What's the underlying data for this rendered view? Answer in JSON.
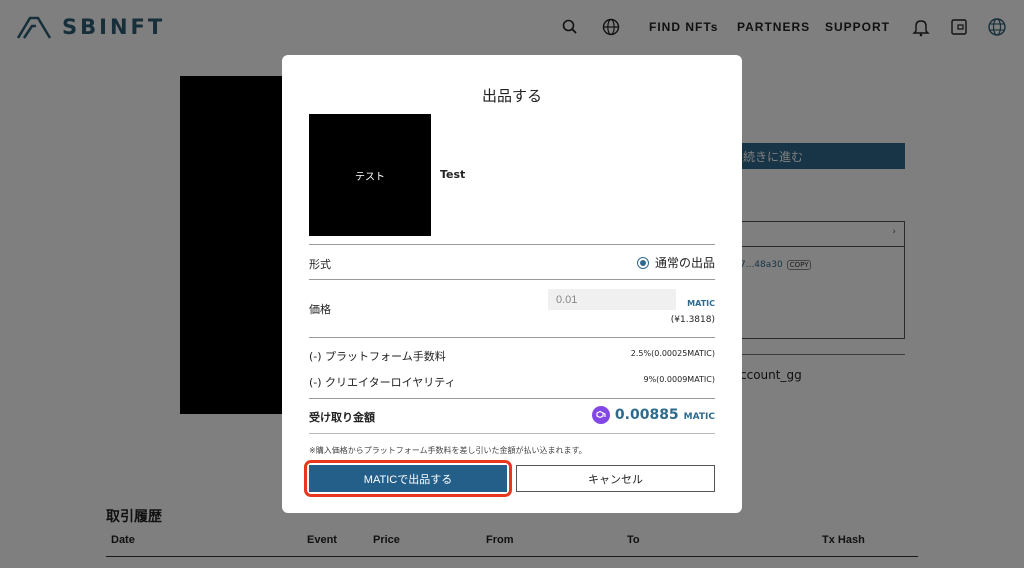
{
  "header": {
    "logo_text": "SBINFT",
    "nav": [
      "FIND NFTs",
      "PARTNERS",
      "SUPPORT"
    ],
    "icons": [
      "search-icon",
      "globe-icon",
      "bell-icon",
      "wallet-icon",
      "network-icon"
    ]
  },
  "background": {
    "proceed_button": "続きに進む",
    "address_text": "7...48a30",
    "copy_label": "COPY",
    "account_text": "ccount_gg",
    "history": {
      "title": "取引履歴",
      "columns": [
        "Date",
        "Event",
        "Price",
        "From",
        "To",
        "Tx Hash"
      ]
    }
  },
  "modal": {
    "title": "出品する",
    "thumbnail_text": "テスト",
    "item_name": "Test",
    "format_label": "形式",
    "format_option": "通常の出品",
    "price_label": "価格",
    "price_value": "0.01",
    "price_unit": "MATIC",
    "price_jpy": "(¥1.3818)",
    "fees": [
      {
        "label": "(-) プラットフォーム手数料",
        "value": "2.5%(0.00025MATIC)"
      },
      {
        "label": "(-) クリエイターロイヤリティ",
        "value": "9%(0.0009MATIC)"
      }
    ],
    "receive_label": "受け取り金額",
    "receive_amount": "0.00885",
    "receive_unit": "MATIC",
    "note": "※購入価格からプラットフォーム手数料を差し引いた金額が払い込まれます。",
    "submit_button": "MATICで出品する",
    "cancel_button": "キャンセル"
  },
  "colors": {
    "accent": "#2f6a8e",
    "primary_button": "#245f8a",
    "highlight": "#e8361f",
    "polygon": "#8247e5"
  }
}
